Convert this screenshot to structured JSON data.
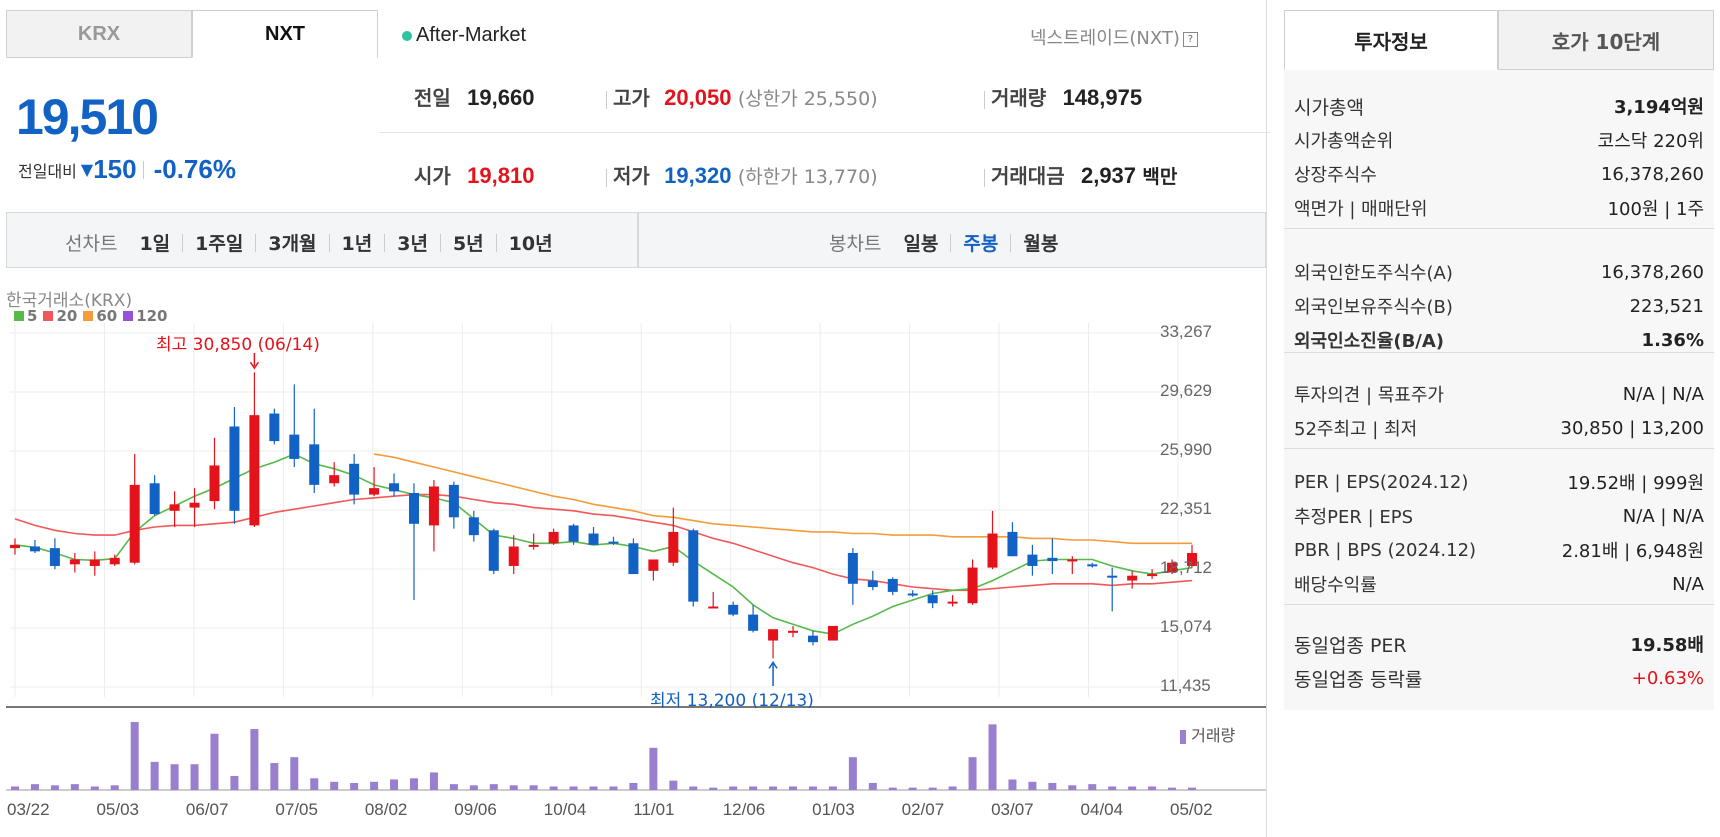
{
  "market_tabs": {
    "krx": "KRX",
    "nxt": "NXT"
  },
  "session": {
    "label": "After-Market",
    "nxt_link": "넥스트레이드(NXT)"
  },
  "price": {
    "current": "19,510",
    "change_label": "전일대비",
    "change": "150",
    "change_pct": "-0.76%"
  },
  "summary": {
    "prev_label": "전일",
    "prev": "19,660",
    "high_label": "고가",
    "high": "20,050",
    "upper_limit": "(상한가 25,550)",
    "volume_label": "거래량",
    "volume": "148,975",
    "open_label": "시가",
    "open": "19,810",
    "low_label": "저가",
    "low": "19,320",
    "lower_limit": "(하한가 13,770)",
    "value_label": "거래대금",
    "value": "2,937",
    "value_unit": "백만"
  },
  "range": {
    "line_label": "선차트",
    "line_options": [
      "1일",
      "1주일",
      "3개월",
      "1년",
      "3년",
      "5년",
      "10년"
    ],
    "candle_label": "봉차트",
    "candle_options": [
      "일봉",
      "주봉",
      "월봉"
    ],
    "candle_selected": "주봉"
  },
  "chart_data": {
    "type": "candlestick",
    "source_label": "한국거래소(KRX)",
    "legend": [
      {
        "name": "5",
        "color": "#56b949"
      },
      {
        "name": "20",
        "color": "#f2575a"
      },
      {
        "name": "60",
        "color": "#f59b3a"
      },
      {
        "name": "120",
        "color": "#9652d8"
      }
    ],
    "y_ticks": [
      "33,267",
      "29,629",
      "25,990",
      "22,351",
      "18,712",
      "15,074",
      "11,435"
    ],
    "ylim": [
      11435,
      33267
    ],
    "x_ticks": [
      "03/22",
      "05/03",
      "06/07",
      "07/05",
      "08/02",
      "09/06",
      "10/04",
      "11/01",
      "12/06",
      "01/03",
      "02/07",
      "03/07",
      "04/04",
      "05/02"
    ],
    "max_annotation": "최고 30,850 (06/14)",
    "min_annotation": "최저 13,200 (12/13)",
    "volume_label": "거래량",
    "candles": [
      [
        20000,
        20600,
        19600,
        20200
      ],
      [
        20100,
        20500,
        19700,
        19800
      ],
      [
        20000,
        20600,
        18700,
        18900
      ],
      [
        19000,
        19700,
        18500,
        19300
      ],
      [
        18900,
        19800,
        18300,
        19300
      ],
      [
        19000,
        19600,
        18900,
        19400
      ],
      [
        19100,
        25800,
        19000,
        23900
      ],
      [
        24000,
        24500,
        22000,
        22100
      ],
      [
        22300,
        23500,
        21300,
        22700
      ],
      [
        22500,
        23700,
        21300,
        22800
      ],
      [
        22900,
        26800,
        22400,
        25100
      ],
      [
        27500,
        28700,
        21500,
        22300
      ],
      [
        21400,
        30850,
        21300,
        28200
      ],
      [
        28300,
        28600,
        26400,
        26600
      ],
      [
        27000,
        30100,
        25000,
        25500
      ],
      [
        26400,
        28600,
        23400,
        23900
      ],
      [
        24000,
        25300,
        23800,
        24500
      ],
      [
        25200,
        25800,
        22700,
        23300
      ],
      [
        23300,
        25000,
        23200,
        23700
      ],
      [
        24000,
        24600,
        23200,
        23500
      ],
      [
        23400,
        24000,
        16800,
        21500
      ],
      [
        21400,
        24200,
        19800,
        23800
      ],
      [
        23900,
        24100,
        21200,
        21900
      ],
      [
        21900,
        22300,
        20400,
        20800
      ],
      [
        21100,
        21200,
        18400,
        18600
      ],
      [
        18900,
        20800,
        18400,
        20100
      ],
      [
        20200,
        20900,
        19900,
        20200
      ],
      [
        20300,
        21200,
        20200,
        21000
      ],
      [
        21400,
        21500,
        20200,
        20400
      ],
      [
        20900,
        21300,
        20200,
        20200
      ],
      [
        20400,
        20700,
        20200,
        20300
      ],
      [
        20300,
        20600,
        18400,
        18400
      ],
      [
        18600,
        18900,
        18000,
        19300
      ],
      [
        19100,
        22500,
        18900,
        21000
      ],
      [
        21100,
        21200,
        16400,
        16700
      ],
      [
        16400,
        17300,
        16300,
        16400
      ],
      [
        16500,
        16700,
        15800,
        15900
      ],
      [
        15900,
        16500,
        14800,
        14900
      ],
      [
        14300,
        14800,
        13200,
        15000
      ],
      [
        14900,
        15200,
        14500,
        14900
      ],
      [
        14600,
        14900,
        14000,
        14200
      ],
      [
        14300,
        15200,
        14300,
        15200
      ],
      [
        19700,
        20000,
        16500,
        17800
      ],
      [
        18000,
        18600,
        17400,
        17600
      ],
      [
        18100,
        18200,
        17100,
        17300
      ],
      [
        17200,
        17400,
        17000,
        17100
      ],
      [
        17100,
        17400,
        16300,
        16600
      ],
      [
        16700,
        17100,
        16400,
        16700
      ],
      [
        16600,
        19300,
        16500,
        18800
      ],
      [
        18800,
        22300,
        18700,
        20900
      ],
      [
        21000,
        21600,
        19500,
        19500
      ],
      [
        19600,
        20200,
        18300,
        18900
      ],
      [
        19400,
        20600,
        18400,
        19200
      ],
      [
        19200,
        19500,
        18400,
        19300
      ],
      [
        19000,
        19100,
        18800,
        18900
      ],
      [
        18300,
        18800,
        16100,
        18200
      ],
      [
        18000,
        18600,
        17500,
        18300
      ],
      [
        18300,
        18700,
        18100,
        18400
      ],
      [
        18500,
        19300,
        18400,
        19100
      ],
      [
        18900,
        20200,
        18800,
        19700
      ]
    ],
    "volumes": [
      3,
      5,
      4,
      5,
      3,
      4,
      58,
      24,
      22,
      22,
      48,
      12,
      52,
      23,
      28,
      10,
      7,
      6,
      7,
      9,
      10,
      15,
      5,
      4,
      5,
      4,
      4,
      3,
      3,
      3,
      3,
      6,
      36,
      8,
      3,
      2,
      3,
      3,
      3,
      3,
      3,
      3,
      28,
      6,
      2,
      2,
      2,
      3,
      28,
      56,
      9,
      7,
      6,
      4,
      5,
      3,
      3,
      3,
      2,
      2
    ],
    "ma5": [
      20200,
      20050,
      19700,
      19300,
      19250,
      19350,
      21000,
      22000,
      22600,
      23200,
      23700,
      24300,
      24900,
      25300,
      25800,
      25200,
      24900,
      24500,
      23900,
      23600,
      23300,
      23100,
      22800,
      21800,
      20800,
      20600,
      20300,
      20300,
      20400,
      20200,
      20300,
      20100,
      19800,
      20100,
      19200,
      18400,
      17600,
      16500,
      15700,
      15300,
      14900,
      14700,
      15300,
      15800,
      16400,
      16800,
      17200,
      17400,
      17500,
      18000,
      18600,
      19200,
      19300,
      19300,
      19300,
      18900,
      18600,
      18400,
      18600,
      18800
    ],
    "ma20": [
      21800,
      21400,
      21100,
      20900,
      20800,
      20800,
      21100,
      21300,
      21400,
      21400,
      21500,
      21600,
      21900,
      22200,
      22400,
      22600,
      22800,
      23000,
      23100,
      23200,
      23300,
      23300,
      23200,
      23000,
      22800,
      22700,
      22500,
      22400,
      22300,
      22100,
      22000,
      21800,
      21600,
      21400,
      21000,
      20600,
      20300,
      19900,
      19500,
      19100,
      18800,
      18400,
      18100,
      18000,
      17800,
      17600,
      17500,
      17400,
      17400,
      17500,
      17600,
      17700,
      17800,
      17800,
      17800,
      17700,
      17800,
      17800,
      17900,
      18000
    ],
    "ma60": [
      null,
      null,
      null,
      null,
      null,
      null,
      null,
      null,
      null,
      null,
      null,
      null,
      null,
      null,
      null,
      null,
      null,
      null,
      25800,
      25600,
      25300,
      25000,
      24700,
      24400,
      24100,
      23800,
      23500,
      23200,
      23000,
      22700,
      22500,
      22300,
      22000,
      21900,
      21700,
      21500,
      21400,
      21300,
      21200,
      21100,
      21000,
      21000,
      20900,
      20900,
      20800,
      20800,
      20800,
      20700,
      20700,
      20700,
      20700,
      20600,
      20600,
      20500,
      20500,
      20400,
      20300,
      20300,
      20300,
      20300
    ]
  },
  "right_panel": {
    "tab_invest": "투자정보",
    "tab_quote": "호가 10단계",
    "rows": [
      {
        "k": "시가총액",
        "v": "3,194억원"
      },
      {
        "k": "시가총액순위",
        "v": "코스닥 220위"
      },
      {
        "k": "상장주식수",
        "v": "16,378,260"
      },
      {
        "k": "액면가 | 매매단위",
        "v": "100원 | 1주"
      },
      {
        "k": "외국인한도주식수(A)",
        "v": "16,378,260"
      },
      {
        "k": "외국인보유주식수(B)",
        "v": "223,521"
      },
      {
        "k": "외국인소진율(B/A)",
        "v": "1.36%"
      },
      {
        "k": "투자의견 | 목표주가",
        "v": "N/A | N/A"
      },
      {
        "k": "52주최고 | 최저",
        "v": "30,850 | 13,200"
      },
      {
        "k": "PER | EPS(2024.12)",
        "v": "19.52배 | 999원"
      },
      {
        "k": "추정PER | EPS",
        "v": "N/A | N/A"
      },
      {
        "k": "PBR | BPS (2024.12)",
        "v": "2.81배 | 6,948원"
      },
      {
        "k": "배당수익률",
        "v": "N/A"
      },
      {
        "k": "동일업종 PER",
        "v": "19.58배"
      },
      {
        "k": "동일업종 등락률",
        "v": "+0.63%"
      }
    ]
  }
}
